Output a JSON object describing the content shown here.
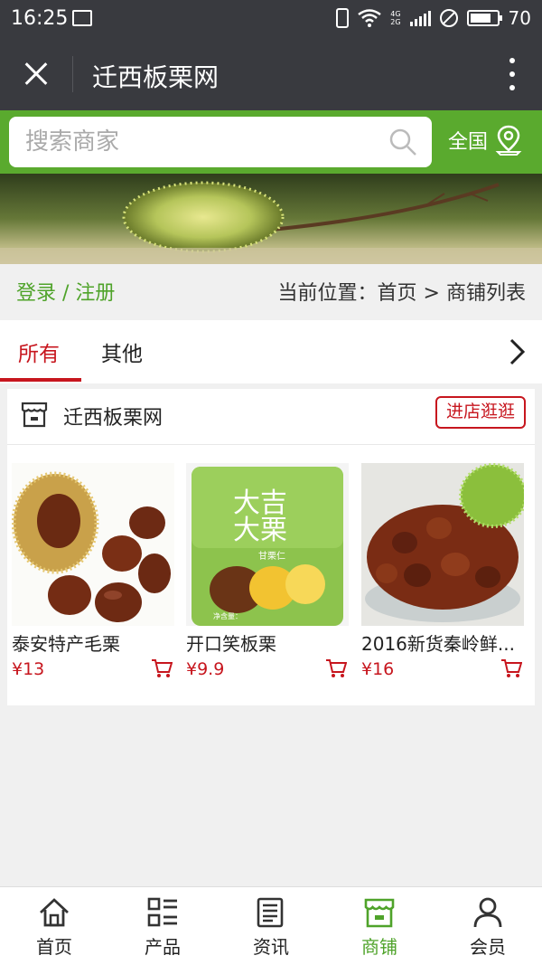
{
  "status_bar": {
    "time": "16:25",
    "net_top": "4G",
    "net_bottom": "2G",
    "battery": "70"
  },
  "header": {
    "title": "迁西板栗网"
  },
  "search": {
    "placeholder": "搜索商家",
    "region_label": "全国"
  },
  "crumbs": {
    "login": "登录 / 注册",
    "location_prefix": "当前位置：",
    "home": "首页",
    "sep": ">",
    "current": "商铺列表"
  },
  "tabs": [
    {
      "label": "所有"
    },
    {
      "label": "其他"
    }
  ],
  "shop": {
    "name": "迁西板栗网",
    "enter_label": "进店逛逛",
    "products": [
      {
        "name": "泰安特产毛栗",
        "price": "¥13"
      },
      {
        "name": "开口笑板栗",
        "price": "¥9.9"
      },
      {
        "name": "2016新货秦岭鲜...",
        "price": "¥16"
      }
    ]
  },
  "package_text": {
    "top_brand": "大吉",
    "top_brand2": "大栗",
    "sub": "甘栗仁",
    "weight": "净含量："
  },
  "bottom_nav": [
    {
      "label": "首页",
      "icon": "home-icon"
    },
    {
      "label": "产品",
      "icon": "grid-list-icon"
    },
    {
      "label": "资讯",
      "icon": "news-icon"
    },
    {
      "label": "商铺",
      "icon": "store-icon"
    },
    {
      "label": "会员",
      "icon": "user-icon"
    }
  ],
  "colors": {
    "accent_green": "#5aaa2e",
    "accent_red": "#c7161e",
    "titlebar": "#393a3f"
  }
}
